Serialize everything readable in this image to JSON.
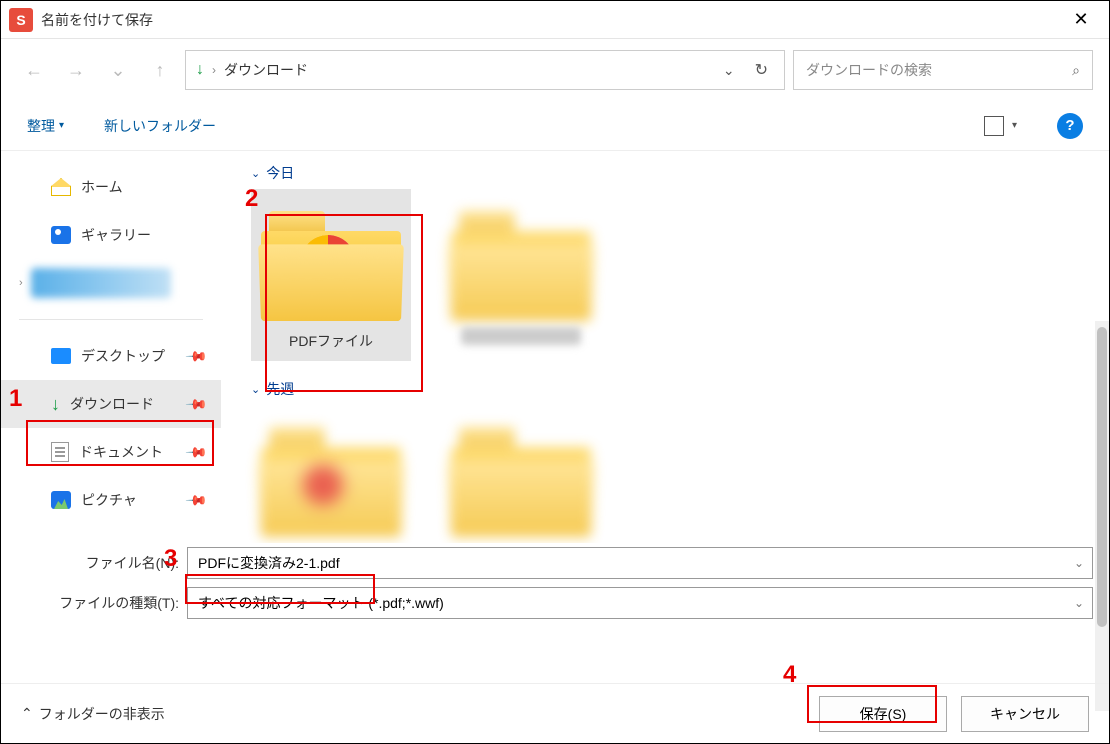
{
  "window": {
    "title": "名前を付けて保存",
    "appicon_letter": "S"
  },
  "nav": {
    "location": "ダウンロード",
    "search_placeholder": "ダウンロードの検索"
  },
  "toolbar": {
    "organize": "整理",
    "new_folder": "新しいフォルダー"
  },
  "sidebar": {
    "home": "ホーム",
    "gallery": "ギャラリー",
    "desktop": "デスクトップ",
    "downloads": "ダウンロード",
    "documents": "ドキュメント",
    "pictures": "ピクチャ"
  },
  "groups": {
    "today": "今日",
    "last_week": "先週"
  },
  "files": {
    "pdf_folder": "PDFファイル"
  },
  "fields": {
    "filename_label": "ファイル名(N):",
    "filename_value": "PDFに変換済み2-1.pdf",
    "filetype_label": "ファイルの種類(T):",
    "filetype_value": "すべての対応フォーマット (*.pdf;*.wwf)"
  },
  "footer": {
    "hide_folders": "フォルダーの非表示",
    "save": "保存(S)",
    "cancel": "キャンセル"
  },
  "annotations": {
    "n1": "1",
    "n2": "2",
    "n3": "3",
    "n4": "4"
  }
}
